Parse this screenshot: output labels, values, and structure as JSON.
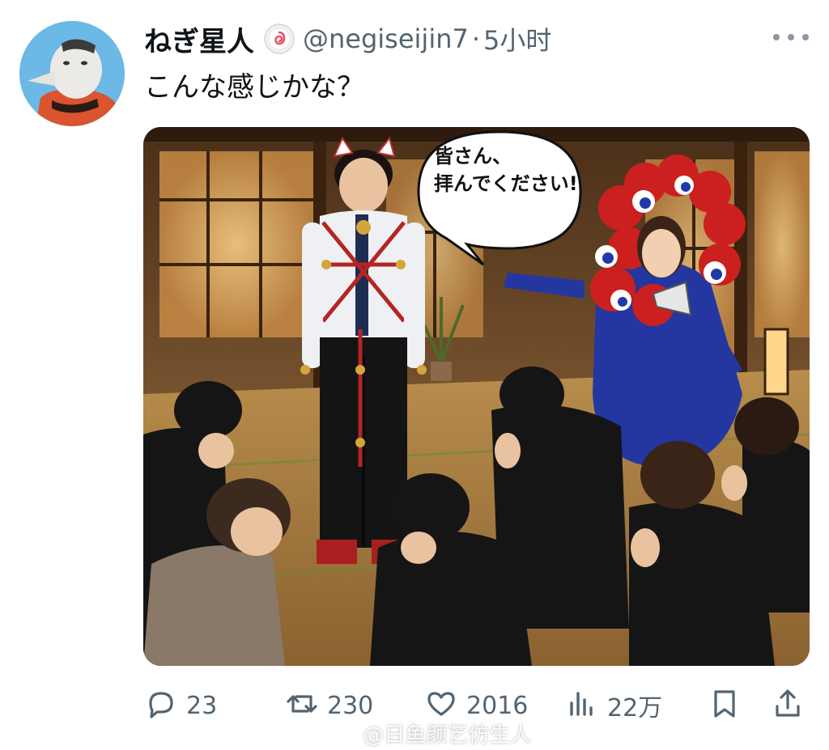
{
  "post": {
    "author": {
      "display_name": "ねぎ星人",
      "handle": "@negiseijin7",
      "badge_icon": "fishcake-icon",
      "avatar_icon": "bird-mascot-avatar"
    },
    "separator": "·",
    "time": "5小时",
    "text": "こんな感じかな？",
    "media": {
      "speech_bubble_lines": [
        "皆さん、",
        "拝んでください!"
      ]
    }
  },
  "actions": {
    "reply_count": "23",
    "repost_count": "230",
    "like_count": "2016",
    "views_count": "22万"
  },
  "watermark": {
    "text": "@日鱼颜艺仿生人",
    "logo_icon": "weibo-icon"
  },
  "colors": {
    "text_primary": "#0f1419",
    "text_secondary": "#536471",
    "background": "#ffffff"
  }
}
